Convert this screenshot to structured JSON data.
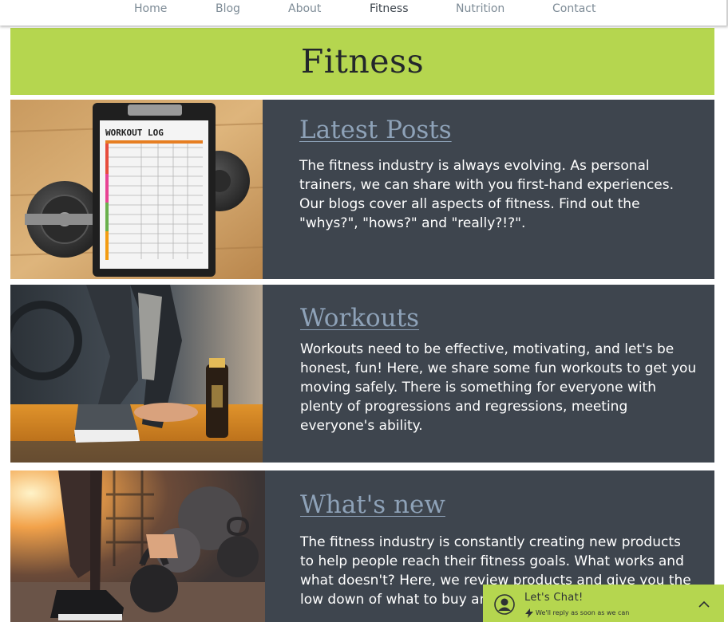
{
  "nav": {
    "items": [
      {
        "label": "Home",
        "active": false
      },
      {
        "label": "Blog",
        "active": false
      },
      {
        "label": "About",
        "active": false
      },
      {
        "label": "Fitness",
        "active": true
      },
      {
        "label": "Nutrition",
        "active": false
      },
      {
        "label": "Contact",
        "active": false
      }
    ]
  },
  "hero": {
    "title": "Fitness"
  },
  "sections": [
    {
      "heading": "Latest Posts",
      "body": "The fitness industry is always evolving. As personal trainers, we can share with you first-hand experiences. Our blogs cover all aspects of fitness. Find out the \"whys?\", \"hows?\" and \"really?!?\"."
    },
    {
      "heading": "Workouts",
      "body": "Workouts need to be effective, motivating, and let's be honest, fun! Here, we share some fun workouts to get you moving safely. There is something for everyone with plenty of progressions and regressions, meeting everyone's ability."
    },
    {
      "heading": "What's new",
      "body": "The fitness industry is constantly creating new products to help people reach their fitness goals. What works and what doesn't? Here, we review products and give you the low down of what to buy and what to avoid."
    }
  ],
  "workout_log": {
    "title": "WORKOUT LOG"
  },
  "chat": {
    "title": "Let's Chat!",
    "subtitle": "We'll reply as soon as we can",
    "icon": "person-icon",
    "toggle_icon": "chevron-up-icon"
  },
  "colors": {
    "accent": "#b5d64f",
    "panel": "#3e454e",
    "heading_link": "#8ea2b8",
    "nav_text": "#7d8b96",
    "nav_active": "#3d454d"
  }
}
